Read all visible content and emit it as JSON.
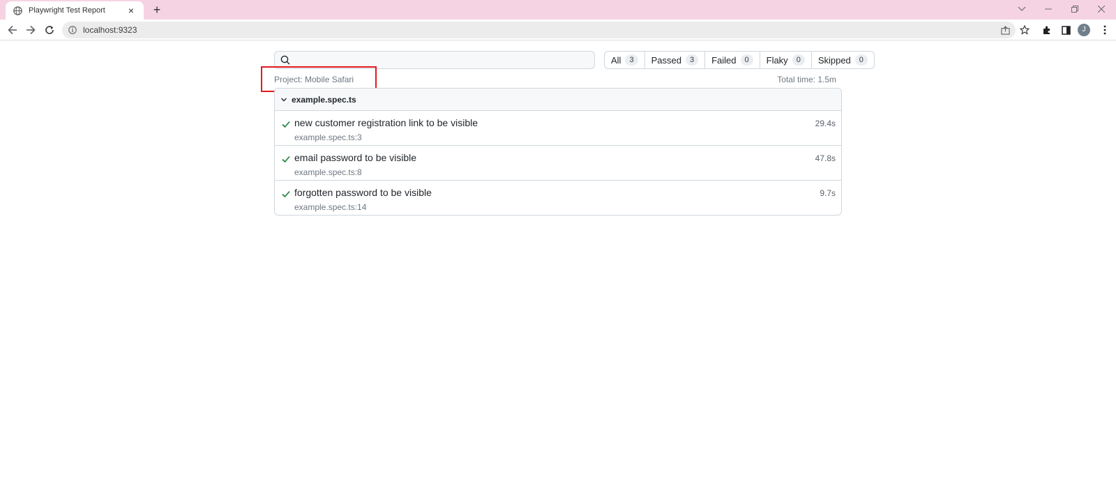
{
  "browser": {
    "tab_title": "Playwright Test Report",
    "tab_close": "×",
    "new_tab": "+",
    "url": "localhost:9323",
    "avatar_letter": "J"
  },
  "report": {
    "search_placeholder": "",
    "filters": [
      {
        "label": "All",
        "count": "3"
      },
      {
        "label": "Passed",
        "count": "3"
      },
      {
        "label": "Failed",
        "count": "0"
      },
      {
        "label": "Flaky",
        "count": "0"
      },
      {
        "label": "Skipped",
        "count": "0"
      }
    ],
    "project": "Project: Mobile Safari",
    "total_time": "Total time: 1.5m",
    "file": {
      "name": "example.spec.ts",
      "tests": [
        {
          "title": "new customer registration link to be visible",
          "location": "example.spec.ts:3",
          "duration": "29.4s",
          "status": "passed"
        },
        {
          "title": "email password to be visible",
          "location": "example.spec.ts:8",
          "duration": "47.8s",
          "status": "passed"
        },
        {
          "title": "forgotten password to be visible",
          "location": "example.spec.ts:14",
          "duration": "9.7s",
          "status": "passed"
        }
      ]
    }
  },
  "colors": {
    "tabbar_bg": "#f6d3e3",
    "pass_green": "#1a7f37",
    "highlight_red": "#e0191f"
  }
}
